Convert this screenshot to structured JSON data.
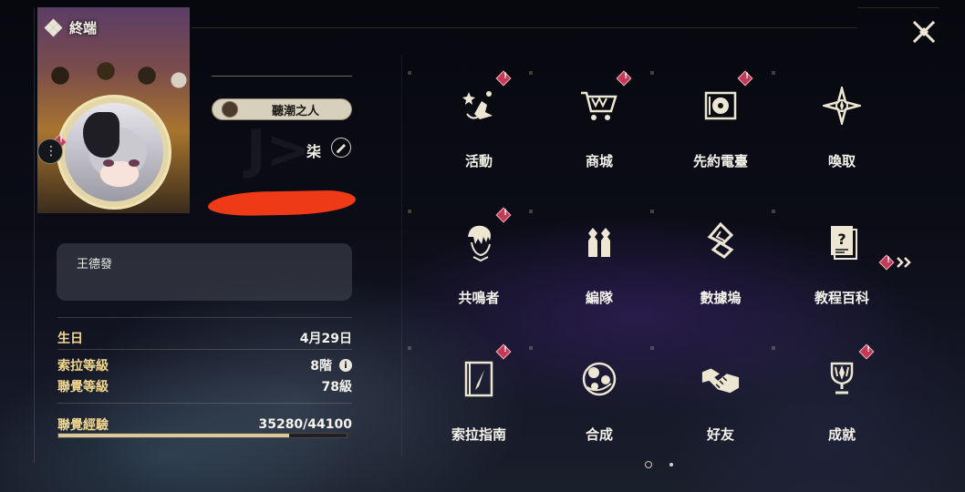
{
  "header": {
    "title": "終端"
  },
  "profile": {
    "title_badge": "聽潮之人",
    "name": "柒",
    "signature": "王德發"
  },
  "stats": {
    "birthday_label": "生日",
    "birthday_value": "4月29日",
    "sola_level_label": "索拉等級",
    "sola_level_value": "8階",
    "union_level_label": "聯覺等級",
    "union_level_value": "78級",
    "union_xp_label": "聯覺經驗",
    "union_xp_value": "35280/44100",
    "union_xp_fraction": 0.8
  },
  "menu": [
    {
      "label": "活動",
      "icon": "event-icon",
      "alert": true
    },
    {
      "label": "商城",
      "icon": "shop-cart-icon",
      "alert": true
    },
    {
      "label": "先約電臺",
      "icon": "radio-icon",
      "alert": true
    },
    {
      "label": "喚取",
      "icon": "summon-star-icon",
      "alert": false
    },
    {
      "label": "共鳴者",
      "icon": "resonator-icon",
      "alert": true
    },
    {
      "label": "編隊",
      "icon": "team-icon",
      "alert": false
    },
    {
      "label": "數據塢",
      "icon": "data-dock-icon",
      "alert": false
    },
    {
      "label": "教程百科",
      "icon": "tutorial-icon",
      "alert": false
    },
    {
      "label": "索拉指南",
      "icon": "guide-book-icon",
      "alert": true
    },
    {
      "label": "合成",
      "icon": "synthesis-icon",
      "alert": false
    },
    {
      "label": "好友",
      "icon": "friends-icon",
      "alert": false
    },
    {
      "label": "成就",
      "icon": "trophy-icon",
      "alert": true
    }
  ],
  "pagination": {
    "current": 1,
    "total": 2
  },
  "colors": {
    "accent_gold": "#f2d88f",
    "alert_red": "#c23a55",
    "xp_fill": "#d9c9a1"
  }
}
